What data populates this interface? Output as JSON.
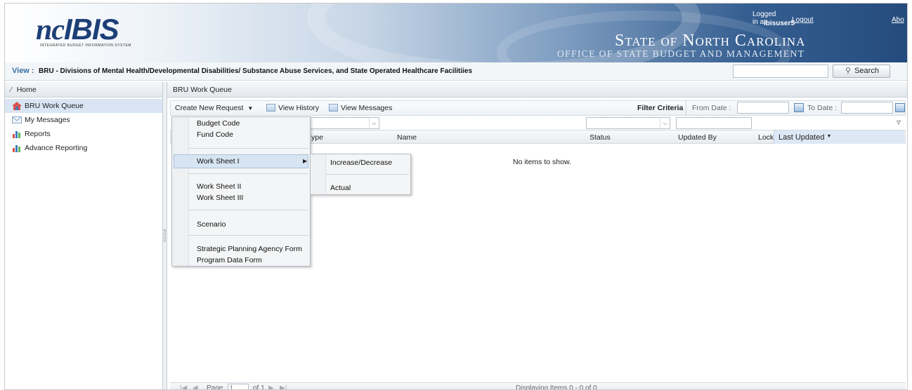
{
  "header": {
    "logo_prefix": "nc",
    "logo_main": "IBIS",
    "logo_sub": "INTEGRATED BUDGET INFORMATION SYSTEM",
    "state_title": "State of North Carolina",
    "office": "OFFICE OF STATE BUDGET AND MANAGEMENT",
    "logged_in_label": "Logged in as",
    "username": "ibisuser5",
    "logout_label": "Logout",
    "about_label": "Abo"
  },
  "viewbar": {
    "label": "View :",
    "text": "BRU - Divisions of Mental Health/Developmental Disabilities/ Substance Abuse Services, and State Operated Healthcare Facilitiies",
    "search_value": "",
    "search_button": "Search"
  },
  "sidebar": {
    "title": "Home",
    "items": [
      {
        "label": "BRU Work Queue",
        "icon": "home-icon",
        "selected": true
      },
      {
        "label": "My Messages",
        "icon": "envelope-icon",
        "selected": false
      },
      {
        "label": "Reports",
        "icon": "bar-chart-icon",
        "selected": false
      },
      {
        "label": "Advance Reporting",
        "icon": "bar-chart-icon",
        "selected": false
      }
    ]
  },
  "main": {
    "title": "BRU Work Queue",
    "toolbar": {
      "create_new": "Create New Request",
      "view_history": "View History",
      "view_messages": "View Messages",
      "filter_criteria": "Filter Criteria",
      "from_date": "From Date :",
      "to_date": "To Date :"
    },
    "columns": [
      "ype",
      "Name",
      "Status",
      "Updated By",
      "Lock",
      "Last Updated"
    ],
    "empty_text": "No items to show.",
    "pager": {
      "page_label": "Page",
      "page_value": "1",
      "of_label": "of 1",
      "displaying": "Displaying Items 0 - 0 of 0"
    }
  },
  "menu": {
    "items": [
      "Budget Code",
      "Fund Code",
      "Work Sheet I",
      "Work Sheet II",
      "Work Sheet III",
      "Scenario",
      "Strategic Planning Agency Form",
      "Program Data Form"
    ],
    "highlighted": "Work Sheet I",
    "submenu": [
      "Increase/Decrease",
      "Actual"
    ]
  },
  "colors": {
    "banner_dark": "#244b7c",
    "accent": "#3a6ea5",
    "selected_bg": "#d9e5f3"
  }
}
